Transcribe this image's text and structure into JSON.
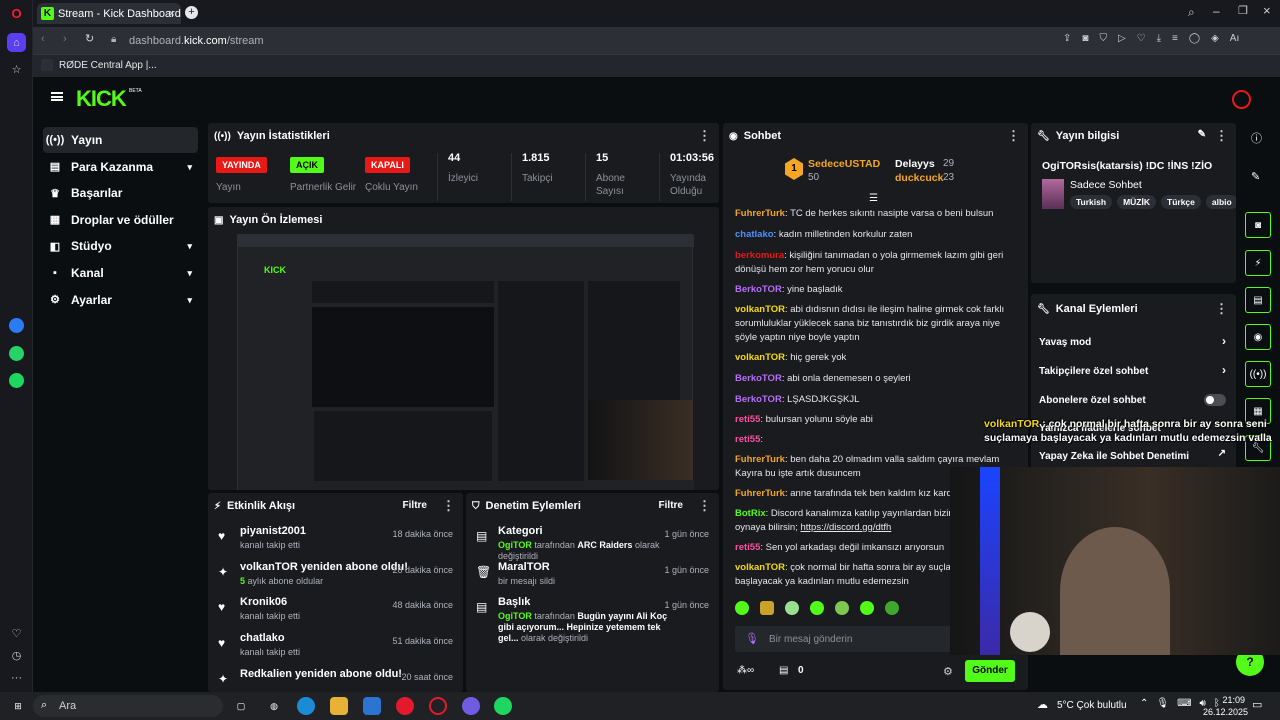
{
  "browser": {
    "tab_title": "Stream - Kick Dashboard",
    "url_prefix": "dashboard.",
    "url_domain": "kick.com",
    "url_path": "/stream",
    "bookmark": "RØDE Central App |..."
  },
  "brand": {
    "logo": "KICK",
    "logo_sup": "BETA",
    "accent": "#53fc18"
  },
  "sidebar": {
    "items": [
      {
        "label": "Yayın",
        "icon": "broadcast-icon"
      },
      {
        "label": "Para Kazanma",
        "icon": "money-icon"
      },
      {
        "label": "Başarılar",
        "icon": "trophy-icon"
      },
      {
        "label": "Droplar ve ödüller",
        "icon": "gift-icon"
      },
      {
        "label": "Stüdyo",
        "icon": "studio-icon"
      },
      {
        "label": "Kanal",
        "icon": "channel-icon"
      },
      {
        "label": "Ayarlar",
        "icon": "settings-icon"
      }
    ]
  },
  "stats": {
    "title": "Yayın İstatistikleri",
    "items": [
      {
        "badge": "YAYINDA",
        "label": "Yayın",
        "color": "#e91916"
      },
      {
        "badge": "AÇIK",
        "label": "Partnerlik Gelir",
        "color": "#53fc18"
      },
      {
        "badge": "KAPALI",
        "label": "Çoklu Yayın",
        "color": "#e91916"
      },
      {
        "value": "44",
        "label": "İzleyici"
      },
      {
        "value": "1.815",
        "label": "Takipçi"
      },
      {
        "value": "15",
        "label": "Abone Sayısı"
      },
      {
        "value": "01:03:56",
        "label": "Yayında Olduğu"
      }
    ]
  },
  "preview": {
    "title": "Yayın Ön İzlemesi"
  },
  "activity": {
    "title": "Etkinlik Akışı",
    "filter": "Filtre",
    "items": [
      {
        "name": "piyanist2001",
        "desc": "kanalı takip etti",
        "time": "18 dakika önce"
      },
      {
        "name": "volkanTOR yeniden abone oldu!",
        "desc_num": "5",
        "desc": "aylık abone oldular",
        "time": "26 dakika önce"
      },
      {
        "name": "Kronik06",
        "desc": "kanalı takip etti",
        "time": "48 dakika önce"
      },
      {
        "name": "chatlako",
        "desc": "kanalı takip etti",
        "time": "51 dakika önce"
      },
      {
        "name": "Redkalien yeniden abone oldu!",
        "desc": "",
        "time": "20 saat önce"
      }
    ]
  },
  "moderation": {
    "title": "Denetim Eylemleri",
    "filter": "Filtre",
    "items": [
      {
        "title": "Kategori",
        "user": "OgiTOR",
        "mid": "tarafından",
        "target": "ARC Raiders",
        "tail": "olarak değiştirildi",
        "time": "1 gün önce"
      },
      {
        "title": "MaralTOR",
        "desc": "bir mesajı sildi",
        "time": "1 gün önce"
      },
      {
        "title": "Başlık",
        "user": "OgiTOR",
        "mid": "tarafından",
        "target": "Bugün yayını Ali Koç gibi açıyorum... Hepinize yetemem tek gel...",
        "tail": "olarak değiştirildi",
        "time": "1 gün önce"
      }
    ]
  },
  "chat": {
    "title": "Sohbet",
    "top": [
      {
        "rank": "1",
        "name": "SedeceUSTAD",
        "count": "50"
      },
      {
        "name": "Delayys",
        "count": "29"
      },
      {
        "name": "duckcuck",
        "count": "23"
      }
    ],
    "messages": [
      {
        "user": "FuhrerTurk",
        "color": "#f5a623",
        "text": "TC de herkes sıkıntı nasipte varsa o beni bulsun"
      },
      {
        "user": "chatlako",
        "color": "#4d90fe",
        "text": "kadın milletinden korkulur zaten"
      },
      {
        "user": "berkomura",
        "color": "#e91916",
        "text": "kişiliğini tanımadan o yola girmemek lazım gibi geri dönüşü hem zor hem yorucu olur"
      },
      {
        "user": "BerkoTOR",
        "color": "#b66df8",
        "text": "yine başladık"
      },
      {
        "user": "volkanTOR",
        "color": "#f5d916",
        "text": "abi dıdısnın dıdısı ile ileşim haline girmek cok farklı sorumluluklar yüklecek sana biz tanıstırdık biz girdik araya niye şöyle yaptın niye boyle yaptın"
      },
      {
        "user": "volkanTOR",
        "color": "#f5d916",
        "text": "hiç gerek yok"
      },
      {
        "user": "BerkoTOR",
        "color": "#b66df8",
        "text": "abi onla denemesen o şeyleri"
      },
      {
        "user": "BerkoTOR",
        "color": "#b66df8",
        "text": "LŞASDJKGŞKJL"
      },
      {
        "user": "reti55",
        "color": "#ff4fa3",
        "text": "bulursan yolunu söyle abi"
      },
      {
        "user": "reti55",
        "color": "#ff4fa3",
        "text": ""
      },
      {
        "user": "FuhrerTurk",
        "color": "#f5a623",
        "text": "ben daha 20 olmadım valla saldım çayıra mevlam Kayıra bu işte artık dusuncem"
      },
      {
        "user": "FuhrerTurk",
        "color": "#f5a623",
        "text": "anne tarafında tek ben kaldım kız karde"
      },
      {
        "user": "BotRix",
        "color": "#53fc18",
        "text": "Discord kanalımıza katılıp yayınlardan bizimle oyun oynaya bilirsin;",
        "link": "https://discord.gg/dtfh"
      },
      {
        "user": "reti55",
        "color": "#ff4fa3",
        "text": "Sen yol arkadaşı değil imkansızı arıyorsun"
      },
      {
        "user": "volkanTOR",
        "color": "#f5d916",
        "text": "çok normal bir hafta sonra bir ay suçlamaya başlayacak ya kadınları mutlu edemezsin"
      }
    ],
    "input_placeholder": "Bir mesaj gönderin",
    "count_label": "0",
    "send": "Gönder"
  },
  "stream_info": {
    "title": "Yayın bilgisi",
    "stream_title": "OgiTORsis(katarsis) !DC !İNS !ZİO",
    "category": "Sadece Sohbet",
    "tags": [
      "Turkish",
      "MÜZİK",
      "Türkçe",
      "albio"
    ]
  },
  "channel_actions": {
    "title": "Kanal Eylemleri",
    "items": [
      {
        "label": "Yavaş mod"
      },
      {
        "label": "Takipçilere özel sohbet"
      },
      {
        "label": "Abonelere özel sohbet"
      },
      {
        "label": "Yalnızca ifadelerle sohbet"
      },
      {
        "label": "Yapay Zeka ile Sohbet Denetimi"
      }
    ]
  },
  "overlay": {
    "user": "volkanTOR",
    "text": "çok normal bir hafta sonra bir ay sonra seni suçlamaya başlayacak ya kadınları mutlu edemezsin valla"
  },
  "taskbar": {
    "search": "Ara",
    "weather": "5°C  Çok bulutlu",
    "time": "21:09",
    "date": "26.12.2025"
  }
}
